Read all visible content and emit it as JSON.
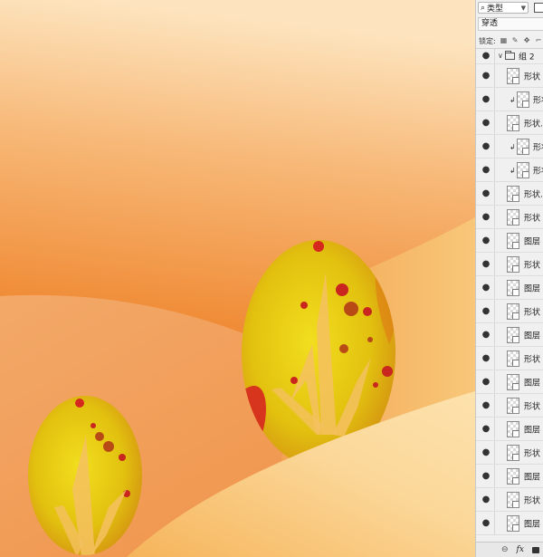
{
  "panel": {
    "filter_label": "类型",
    "filter_search_icon": "search-icon",
    "blend_mode": "穿透",
    "lock_label": "锁定:",
    "group_name": "组 2"
  },
  "layers": [
    {
      "name": "形状",
      "clip": false
    },
    {
      "name": "形状",
      "clip": true
    },
    {
      "name": "形状...",
      "clip": false
    },
    {
      "name": "形状",
      "clip": true
    },
    {
      "name": "形状",
      "clip": true
    },
    {
      "name": "形状...",
      "clip": false
    },
    {
      "name": "形状",
      "clip": false
    },
    {
      "name": "图层",
      "clip": false
    },
    {
      "name": "形状",
      "clip": false
    },
    {
      "name": "图层",
      "clip": false
    },
    {
      "name": "形状",
      "clip": false
    },
    {
      "name": "图层",
      "clip": false
    },
    {
      "name": "形状",
      "clip": false
    },
    {
      "name": "图层",
      "clip": false
    },
    {
      "name": "形状",
      "clip": false
    },
    {
      "name": "图层",
      "clip": false
    },
    {
      "name": "形状",
      "clip": false
    },
    {
      "name": "图层",
      "clip": false
    },
    {
      "name": "形状",
      "clip": false
    },
    {
      "name": "图层",
      "clip": false
    }
  ],
  "bottom": {
    "link_icon": "link-icon",
    "fx_label": "fx",
    "mask_icon": "mask-icon"
  },
  "colors": {
    "sky_top": "#fbdcb0",
    "sky_bottom": "#ee8a2e",
    "hill_light": "#f9c97a",
    "egg_yellow": "#e8cf14",
    "egg_red": "#c8261e"
  }
}
